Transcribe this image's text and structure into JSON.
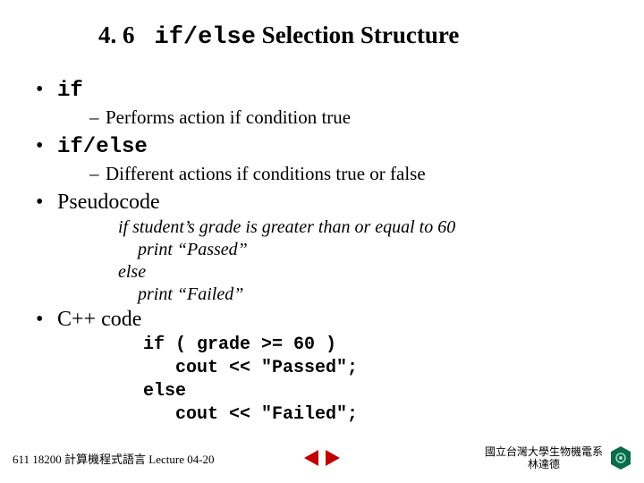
{
  "title": {
    "section": "4. 6",
    "code": "if/else",
    "rest": " Selection Structure"
  },
  "bullets": {
    "if_kw": "if",
    "if_desc": "Performs action if condition true",
    "ifelse_kw": "if/else",
    "ifelse_desc": "Different actions if conditions true or false",
    "pseudocode_label": "Pseudocode",
    "cpp_label": "C++ code"
  },
  "pseudo": {
    "l1": "if student’s grade is greater than or equal to 60",
    "l2": "print “Passed”",
    "l3": "else",
    "l4": "print “Failed”"
  },
  "code": {
    "block": "if ( grade >= 60 )\n   cout << \"Passed\";\nelse\n   cout << \"Failed\";"
  },
  "footer": {
    "left": "611 18200 計算機程式語言  Lecture 04-20",
    "org1": "國立台灣大學生物機電系",
    "org2": "林達德"
  }
}
